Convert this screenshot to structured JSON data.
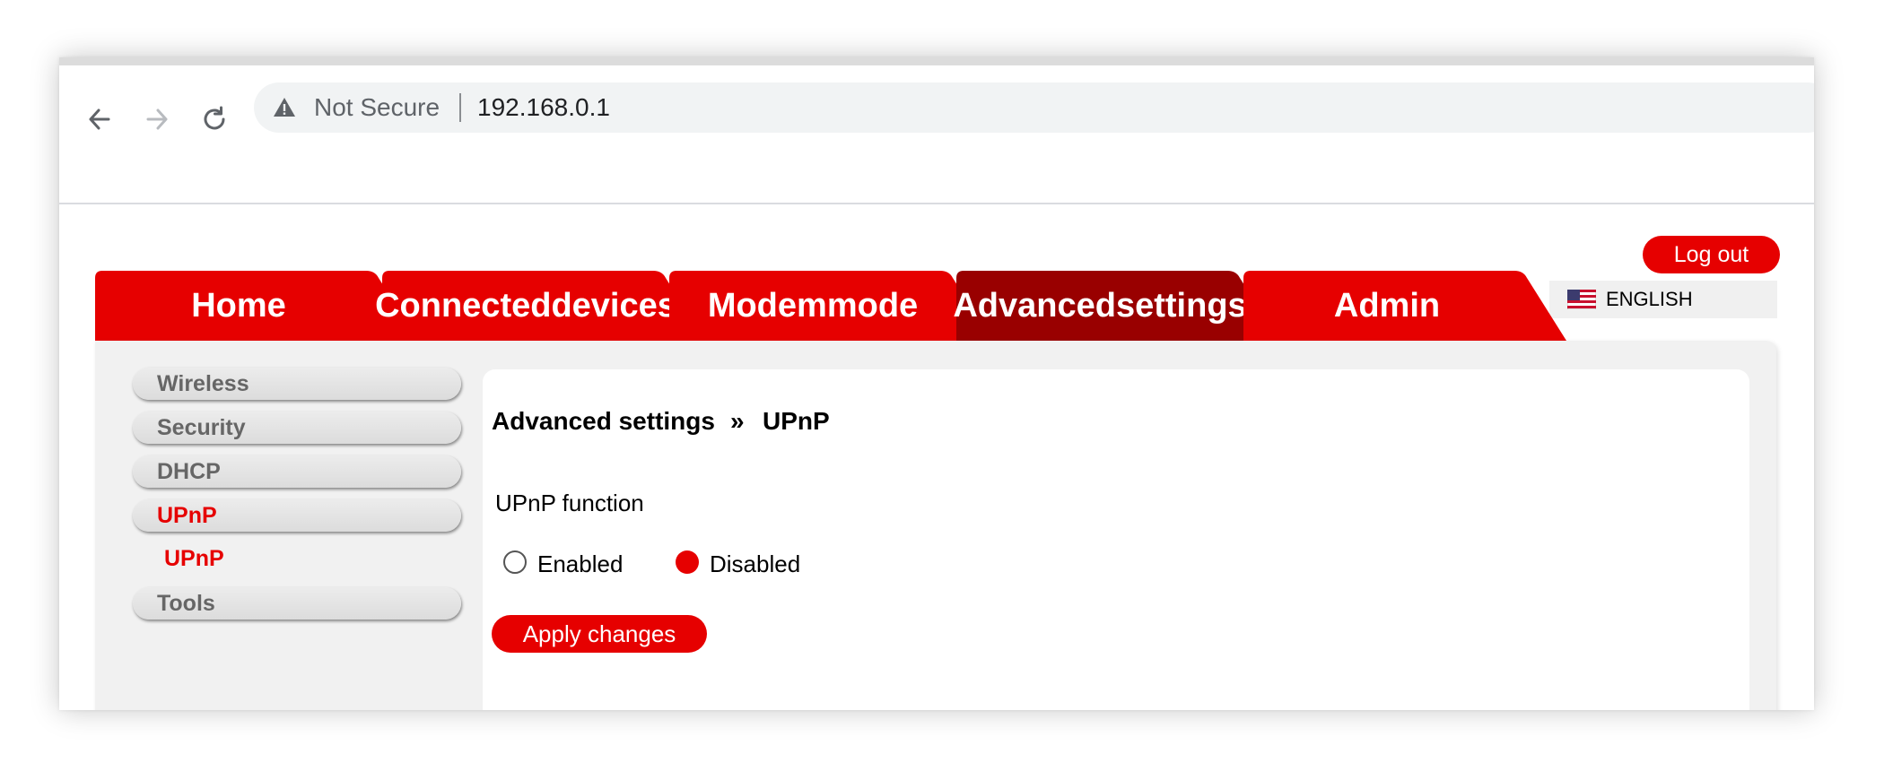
{
  "browser": {
    "back_icon": "arrow-left-icon",
    "forward_icon": "arrow-right-icon",
    "reload_icon": "reload-icon",
    "security_icon": "warning-triangle-icon",
    "security_text": "Not Secure",
    "url": "192.168.0.1"
  },
  "header": {
    "logout_label": "Log out",
    "language": {
      "selected": "ENGLISH",
      "flag_icon": "us-flag-icon"
    }
  },
  "tabs": [
    {
      "lines": [
        "Home"
      ],
      "active": false
    },
    {
      "lines": [
        "Connected",
        "devices"
      ],
      "active": false
    },
    {
      "lines": [
        "Modem",
        "mode"
      ],
      "active": false
    },
    {
      "lines": [
        "Advanced",
        "settings"
      ],
      "active": true
    },
    {
      "lines": [
        "Admin"
      ],
      "active": false
    }
  ],
  "sidebar": {
    "items": [
      {
        "label": "Wireless",
        "active": false
      },
      {
        "label": "Security",
        "active": false
      },
      {
        "label": "DHCP",
        "active": false
      },
      {
        "label": "UPnP",
        "active": true
      },
      {
        "label": "Tools",
        "active": false
      }
    ],
    "subitems": [
      {
        "label": "UPnP",
        "active": true
      }
    ]
  },
  "main": {
    "breadcrumb": {
      "parent": "Advanced settings",
      "separator": "»",
      "current": "UPnP"
    },
    "upnp_function_label": "UPnP function",
    "options": [
      {
        "label": "Enabled",
        "selected": false
      },
      {
        "label": "Disabled",
        "selected": true
      }
    ],
    "apply_label": "Apply changes"
  },
  "colors": {
    "brand_red": "#e60000",
    "active_tab": "#990000",
    "panel_bg": "#f1f1f1",
    "sidebar_text": "#666666"
  }
}
